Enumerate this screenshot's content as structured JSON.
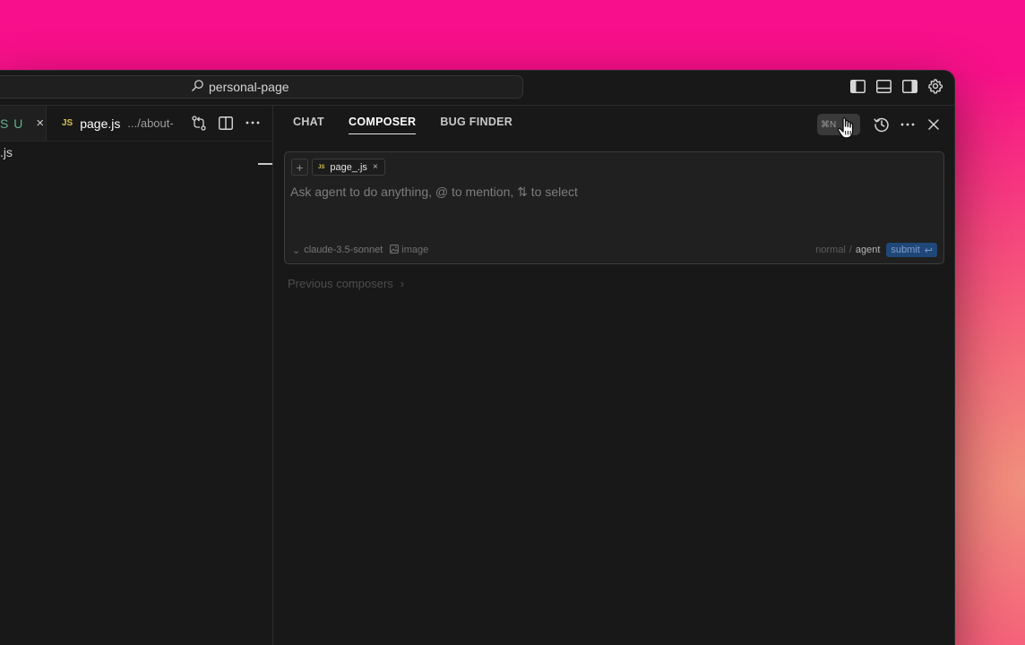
{
  "titlebar": {
    "search_text": "personal-page",
    "actions": [
      {
        "icon": "toggle-primary-sidebar-icon"
      },
      {
        "icon": "toggle-panel-icon"
      },
      {
        "icon": "toggle-secondary-sidebar-icon"
      },
      {
        "icon": "settings-gear-icon"
      }
    ]
  },
  "editor": {
    "prev_tab": {
      "status": "S U",
      "close": "×"
    },
    "active_tab": {
      "badge": "JS",
      "name": "page.js",
      "path": ".../about-"
    },
    "line_text": ".js",
    "actions": [
      "source-control-icon",
      "split-editor-icon",
      "more-icon"
    ]
  },
  "panel": {
    "tabs": [
      {
        "label": "CHAT",
        "active": false
      },
      {
        "label": "COMPOSER",
        "active": true
      },
      {
        "label": "BUG FINDER",
        "active": false
      }
    ],
    "new_shortcut": "⌘N",
    "composer": {
      "add_context": "+",
      "chip": {
        "badge": "JS",
        "name": "page_.js",
        "close": "×"
      },
      "placeholder": "Ask agent to do anything, @ to mention, ⇅ to select",
      "model_chevron": "⌄",
      "model": "claude-3.5-sonnet",
      "image_label": "image",
      "mode_normal": "normal",
      "mode_sep": "/",
      "mode_agent": "agent",
      "submit_label": "submit",
      "submit_glyph": "↩"
    },
    "previous_composers": "Previous composers",
    "previous_chevron": "›"
  },
  "colors": {
    "background_pink": "#f80f8c",
    "window_bg": "#181818",
    "submit_bg": "#1f4778",
    "js_yellow": "#d8c14f",
    "git_untracked_green": "#62b18b"
  }
}
